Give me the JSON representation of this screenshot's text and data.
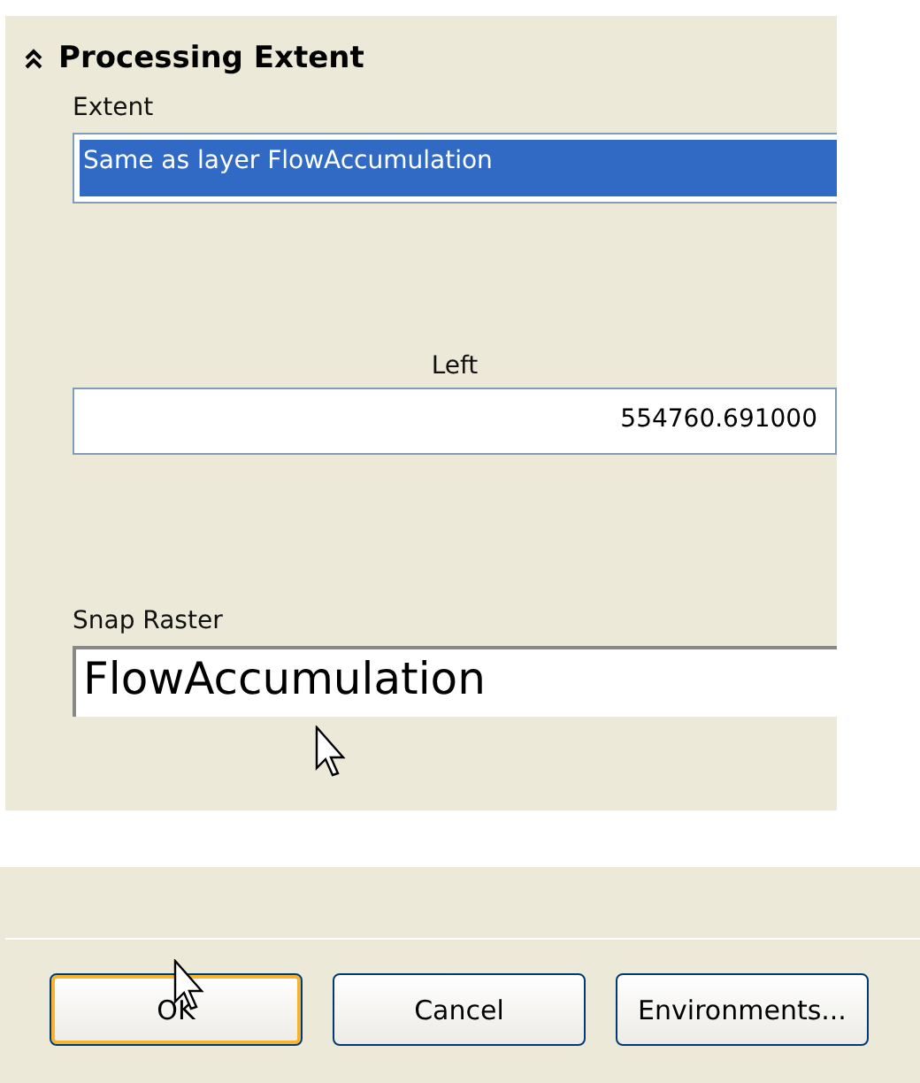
{
  "section": {
    "title": "Processing Extent",
    "expanded": true
  },
  "extent": {
    "label": "Extent",
    "value": "Same as layer FlowAccumulation",
    "selected": true
  },
  "left": {
    "label": "Left",
    "value": "554760.691000"
  },
  "snap_raster": {
    "label": "Snap Raster",
    "value": "FlowAccumulation"
  },
  "buttons": [
    {
      "label": "OK",
      "default": true
    },
    {
      "label": "Cancel",
      "default": false
    },
    {
      "label": "Environments...",
      "default": false
    }
  ]
}
